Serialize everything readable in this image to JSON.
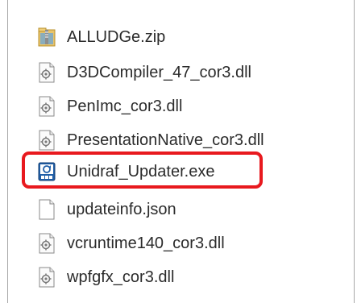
{
  "files": [
    {
      "name": "ALLUDGe.zip",
      "icon": "zip-folder-icon"
    },
    {
      "name": "D3DCompiler_47_cor3.dll",
      "icon": "dll-file-icon"
    },
    {
      "name": "PenImc_cor3.dll",
      "icon": "dll-file-icon"
    },
    {
      "name": "PresentationNative_cor3.dll",
      "icon": "dll-file-icon"
    },
    {
      "name": "Unidraf_Updater.exe",
      "icon": "exe-app-icon"
    },
    {
      "name": "updateinfo.json",
      "icon": "blank-file-icon"
    },
    {
      "name": "vcruntime140_cor3.dll",
      "icon": "dll-file-icon"
    },
    {
      "name": "wpfgfx_cor3.dll",
      "icon": "dll-file-icon"
    }
  ],
  "highlight_color": "#e8191e",
  "highlighted_file": "Unidraf_Updater.exe"
}
